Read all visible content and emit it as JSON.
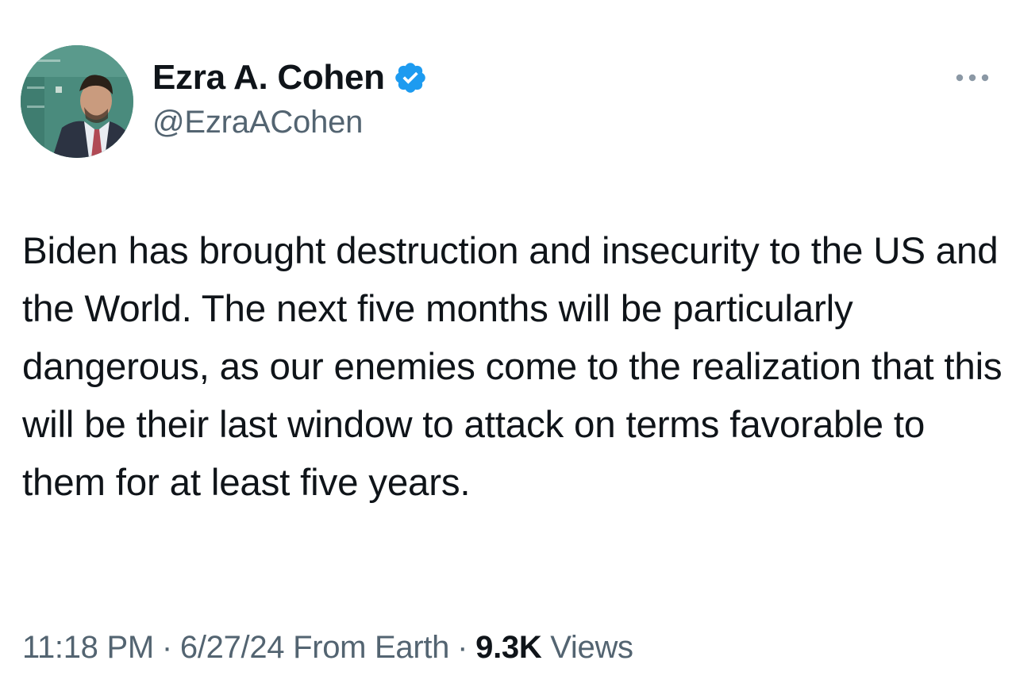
{
  "author": {
    "display_name": "Ezra A. Cohen",
    "handle": "@EzraACohen",
    "verified": true,
    "verified_color": "#1d9bf0"
  },
  "icons": {
    "avatar": "profile-photo",
    "verified": "verified-badge-icon",
    "more": "more-options-icon"
  },
  "tweet": {
    "text": "Biden has brought destruction and insecurity to the US and the World. The next five months will be particularly dangerous, as our enemies come to the realization that this will be their last window to attack on terms favorable to them for at least five years."
  },
  "meta": {
    "time": "11:18 PM",
    "separator": "·",
    "date": "6/27/24",
    "location": "From Earth",
    "views_count": "9.3K",
    "views_label": "Views"
  },
  "colors": {
    "text_primary": "#0f1419",
    "text_secondary": "#536471",
    "background": "#ffffff"
  }
}
